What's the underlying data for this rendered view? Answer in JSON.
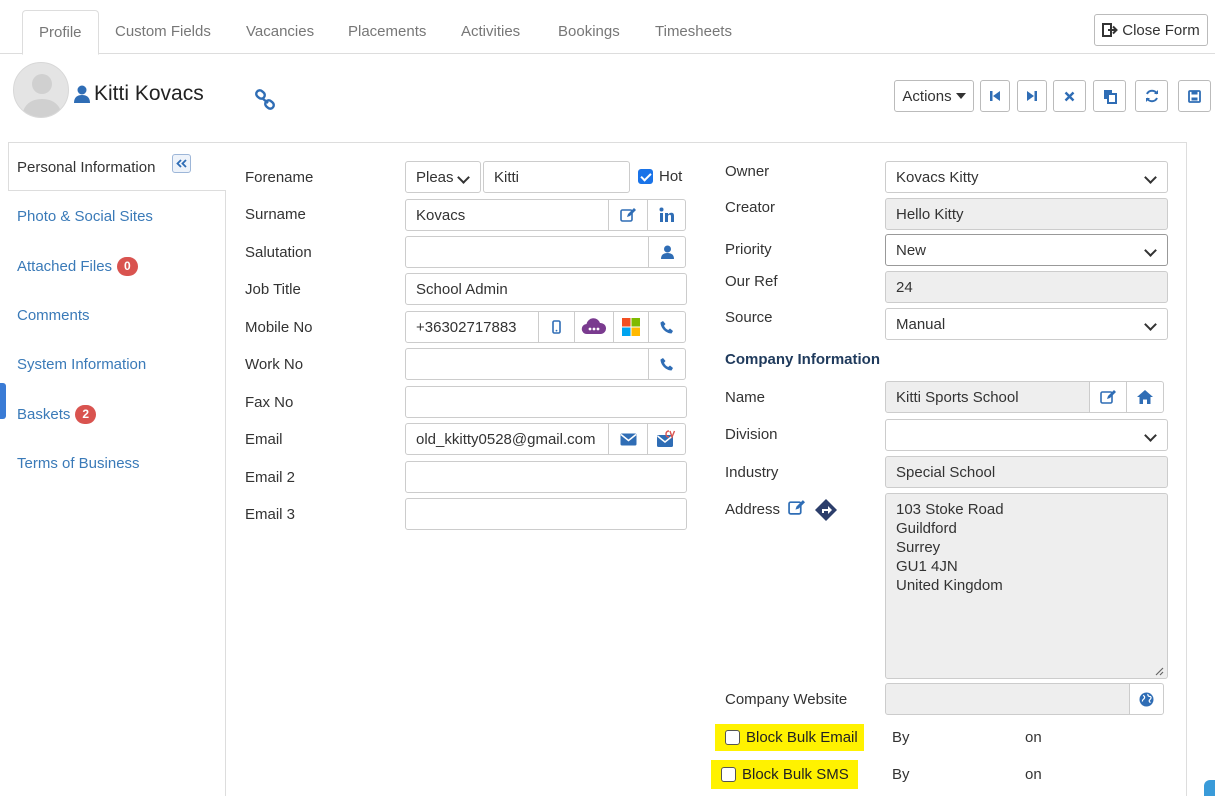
{
  "tabs": [
    "Profile",
    "Custom Fields",
    "Vacancies",
    "Placements",
    "Activities",
    "Bookings",
    "Timesheets"
  ],
  "close_form": "Close Form",
  "contact_name": "Kitti Kovacs",
  "actions_label": "Actions",
  "leftnav": {
    "personal": "Personal Information",
    "photo": "Photo & Social Sites",
    "files": "Attached Files",
    "files_count": "0",
    "comments": "Comments",
    "system": "System Information",
    "baskets": "Baskets",
    "baskets_count": "2",
    "terms": "Terms of Business"
  },
  "left_form": {
    "forename_label": "Forename",
    "title_value": "Pleas",
    "forename_value": "Kitti",
    "hot_label": "Hot",
    "hot_checked": true,
    "surname_label": "Surname",
    "surname_value": "Kovacs",
    "salutation_label": "Salutation",
    "salutation_value": "",
    "jobtitle_label": "Job Title",
    "jobtitle_value": "School Admin",
    "mobile_label": "Mobile No",
    "mobile_value": "+36302717883",
    "work_label": "Work No",
    "work_value": "",
    "fax_label": "Fax No",
    "fax_value": "",
    "email_label": "Email",
    "email_value": "old_kkitty0528@gmail.com",
    "email2_label": "Email 2",
    "email3_label": "Email 3"
  },
  "right_form": {
    "owner_label": "Owner",
    "owner_value": "Kovacs Kitty",
    "creator_label": "Creator",
    "creator_value": "Hello Kitty",
    "priority_label": "Priority",
    "priority_value": "New",
    "ourref_label": "Our Ref",
    "ourref_value": "24",
    "source_label": "Source",
    "source_value": "Manual",
    "company_heading": "Company Information",
    "name_label": "Name",
    "name_value": "Kitti Sports School",
    "division_label": "Division",
    "division_value": "",
    "industry_label": "Industry",
    "industry_value": "Special School",
    "address_label": "Address",
    "address_value": "103 Stoke Road\nGuildford\nSurrey\nGU1 4JN\nUnited Kingdom",
    "website_label": "Company Website",
    "website_value": "",
    "block_email_label": "Block Bulk Email",
    "block_sms_label": "Block Bulk SMS",
    "by_label": "By",
    "on_label": "on"
  },
  "colors": {
    "link": "#3a7ab8",
    "icon_blue": "#2f6db5",
    "badge": "#d9534f",
    "highlight": "#fff200"
  }
}
